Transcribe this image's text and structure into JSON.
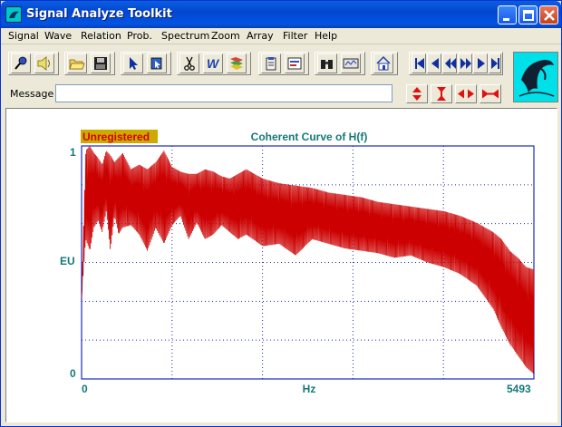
{
  "window": {
    "title": "Signal Analyze Toolkit"
  },
  "menu": [
    "Signal",
    "Wave",
    "Relation",
    "Prob.",
    "Spectrum",
    "Zoom",
    "Array",
    "Filter",
    "Help"
  ],
  "message": {
    "label": "Message",
    "value": ""
  },
  "icons": {
    "toolbar_group1": [
      "microphone-icon",
      "speaker-icon"
    ],
    "toolbar_group2": [
      "open-folder-icon",
      "save-disk-icon"
    ],
    "toolbar_group3": [
      "pointer-arrow-icon",
      "select-region-icon"
    ],
    "toolbar_group4": [
      "scissors-icon",
      "w-wave-icon",
      "filter-icon"
    ],
    "toolbar_group5": [
      "clipboard-icon",
      "chart-icon"
    ],
    "toolbar_group6": [
      "binoculars-icon",
      "monitor-icon"
    ],
    "toolbar_group7": [
      "home-icon"
    ],
    "navigation": [
      "skip-first-icon",
      "step-back-icon",
      "rewind-icon",
      "fast-forward-icon",
      "step-forward-icon",
      "skip-last-icon"
    ],
    "zoom": [
      "zoom-out-vertical-icon",
      "zoom-in-vertical-icon",
      "zoom-out-horizontal-icon",
      "zoom-in-horizontal-icon"
    ],
    "logo": "dolphin-logo-icon"
  },
  "chart": {
    "watermark": "Unregistered",
    "title": "Coherent Curve of H(f)",
    "ylabel": "EU",
    "xlabel": "Hz",
    "y_top_label": "1",
    "y_bottom_label": "0",
    "x_left_label": "0",
    "x_right_label": "5493"
  },
  "chart_data": {
    "type": "line",
    "title": "Coherent Curve of H(f)",
    "xlabel": "Hz",
    "ylabel": "EU",
    "xlim": [
      0,
      5493
    ],
    "ylim": [
      0,
      1
    ],
    "grid": true,
    "series": [
      {
        "color": "#cc0000",
        "x": [
          0,
          50,
          100,
          150,
          200,
          250,
          300,
          350,
          400,
          450,
          500,
          600,
          700,
          800,
          900,
          1000,
          1100,
          1200,
          1300,
          1400,
          1500,
          1600,
          1700,
          1800,
          1900,
          2000,
          2200,
          2400,
          2600,
          2800,
          3000,
          3200,
          3400,
          3600,
          3800,
          4000,
          4200,
          4400,
          4600,
          4800,
          5000,
          5100,
          5200,
          5300,
          5400,
          5493
        ],
        "y_upper": [
          0.35,
          0.98,
          1.0,
          0.97,
          0.95,
          0.92,
          0.98,
          0.96,
          0.93,
          0.95,
          0.97,
          0.9,
          0.92,
          0.9,
          0.93,
          0.98,
          0.91,
          0.89,
          0.88,
          0.88,
          0.9,
          0.89,
          0.87,
          0.86,
          0.88,
          0.9,
          0.86,
          0.84,
          0.83,
          0.82,
          0.8,
          0.79,
          0.78,
          0.76,
          0.75,
          0.74,
          0.73,
          0.72,
          0.7,
          0.67,
          0.63,
          0.6,
          0.55,
          0.52,
          0.48,
          0.47
        ],
        "y_lower": [
          0.35,
          0.6,
          0.55,
          0.65,
          0.68,
          0.63,
          0.72,
          0.55,
          0.7,
          0.62,
          0.65,
          0.66,
          0.62,
          0.55,
          0.65,
          0.58,
          0.66,
          0.7,
          0.6,
          0.67,
          0.6,
          0.62,
          0.66,
          0.63,
          0.6,
          0.62,
          0.57,
          0.58,
          0.53,
          0.6,
          0.58,
          0.56,
          0.55,
          0.54,
          0.52,
          0.53,
          0.5,
          0.48,
          0.45,
          0.4,
          0.3,
          0.22,
          0.15,
          0.1,
          0.05,
          0.02
        ]
      }
    ]
  }
}
